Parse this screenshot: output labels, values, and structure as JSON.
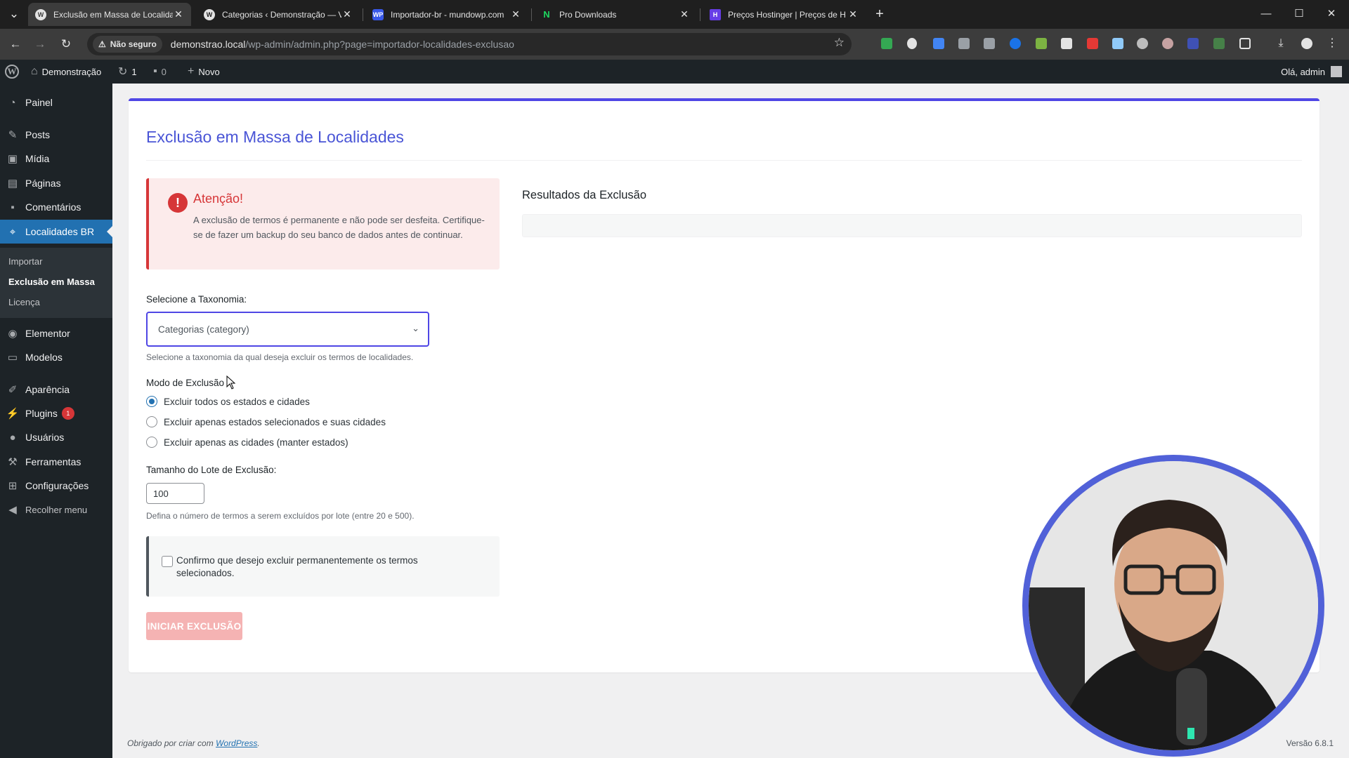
{
  "browser": {
    "tabs": [
      {
        "title": "Exclusão em Massa de Localida",
        "active": true,
        "icon": "wordpress-icon"
      },
      {
        "title": "Categorias ‹ Demonstração — V",
        "active": false,
        "icon": "wordpress-icon"
      },
      {
        "title": "Importador-br - mundowp.com",
        "active": false,
        "icon": "wp-badge-icon"
      },
      {
        "title": "Pro Downloads",
        "active": false,
        "icon": "n-logo-icon"
      },
      {
        "title": "Preços Hostinger | Preços de H",
        "active": false,
        "icon": "hostinger-icon"
      }
    ],
    "security_label": "Não seguro",
    "url_host": "demonstrao.local",
    "url_path": "/wp-admin/admin.php?page=importador-localidades-exclusao"
  },
  "adminbar": {
    "site_name": "Demonstração",
    "updates_count": "1",
    "comments_count": "0",
    "new_label": "Novo",
    "howdy": "Olá, admin"
  },
  "sidebar": {
    "items": [
      {
        "label": "Painel",
        "icon": "dashboard-icon"
      },
      {
        "label": "Posts",
        "icon": "pin-icon"
      },
      {
        "label": "Mídia",
        "icon": "media-icon"
      },
      {
        "label": "Páginas",
        "icon": "page-icon"
      },
      {
        "label": "Comentários",
        "icon": "comment-icon"
      },
      {
        "label": "Localidades BR",
        "icon": "location-icon",
        "current": true
      },
      {
        "label": "Elementor",
        "icon": "elementor-icon"
      },
      {
        "label": "Modelos",
        "icon": "folder-icon"
      },
      {
        "label": "Aparência",
        "icon": "brush-icon"
      },
      {
        "label": "Plugins",
        "icon": "plugin-icon",
        "badge": "1"
      },
      {
        "label": "Usuários",
        "icon": "user-icon"
      },
      {
        "label": "Ferramentas",
        "icon": "wrench-icon"
      },
      {
        "label": "Configurações",
        "icon": "settings-icon"
      },
      {
        "label": "Recolher menu",
        "icon": "collapse-icon"
      }
    ],
    "submenu": [
      {
        "label": "Importar"
      },
      {
        "label": "Exclusão em Massa",
        "current": true
      },
      {
        "label": "Licença"
      }
    ]
  },
  "page": {
    "title": "Exclusão em Massa de Localidades",
    "notice": {
      "title": "Atenção!",
      "text": "A exclusão de termos é permanente e não pode ser desfeita. Certifique-se de fazer um backup do seu banco de dados antes de continuar."
    },
    "taxonomy": {
      "label": "Selecione a Taxonomia:",
      "selected": "Categorias (category)",
      "help": "Selecione a taxonomia da qual deseja excluir os termos de localidades."
    },
    "mode": {
      "label": "Modo de Exclusão",
      "options": [
        {
          "label": "Excluir todos os estados e cidades",
          "checked": true
        },
        {
          "label": "Excluir apenas estados selecionados e suas cidades",
          "checked": false
        },
        {
          "label": "Excluir apenas as cidades (manter estados)",
          "checked": false
        }
      ]
    },
    "batch": {
      "label": "Tamanho do Lote de Exclusão:",
      "value": "100",
      "help": "Defina o número de termos a serem excluídos por lote (entre 20 e 500)."
    },
    "confirm": {
      "text": "Confirmo que desejo excluir permanentemente os termos selecionados.",
      "checked": false
    },
    "start_button": "INICIAR EXCLUSÃO",
    "results_title": "Resultados da Exclusão"
  },
  "footer": {
    "thanks_prefix": "Obrigado por criar com",
    "thanks_link": "WordPress",
    "thanks_suffix": ".",
    "version": "Versão 6.8.1"
  },
  "colors": {
    "accent": "#4f46e5",
    "wp_blue": "#2271b1",
    "danger": "#d63638",
    "button_disabled": "#f5b3b3",
    "admin_dark": "#1d2327"
  }
}
